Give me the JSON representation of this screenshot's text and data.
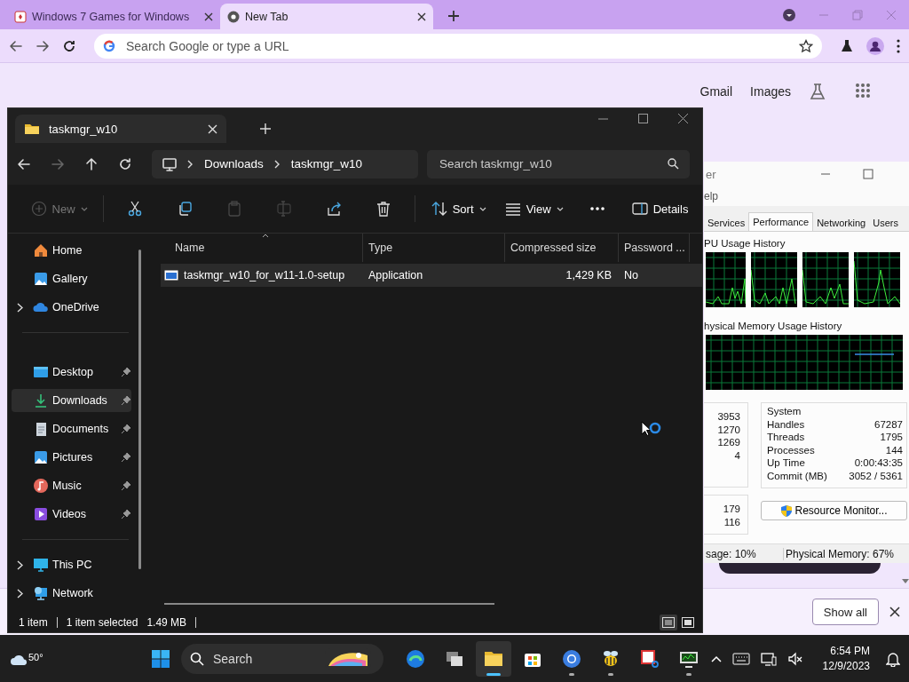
{
  "browser": {
    "tabs": [
      {
        "title": "Windows 7 Games for Windows",
        "selected": false
      },
      {
        "title": "New Tab",
        "selected": true
      }
    ],
    "omnibox": {
      "placeholder": "Search Google or type a URL"
    },
    "links": [
      "Gmail",
      "Images"
    ],
    "download_bar": {
      "button": "Show all"
    }
  },
  "task_manager": {
    "title": "er",
    "menu": [
      "elp"
    ],
    "tabs": [
      {
        "label": "Services",
        "selected": false
      },
      {
        "label": "Performance",
        "selected": true
      },
      {
        "label": "Networking",
        "selected": false
      },
      {
        "label": "Users",
        "selected": false
      }
    ],
    "cpu_heading": "PU Usage History",
    "memory_heading": "hysical Memory Usage History",
    "values_1": [
      "3953",
      "1270",
      "1269",
      "4"
    ],
    "values_2": [
      "179",
      "116"
    ],
    "system": {
      "heading": "System",
      "rows": [
        {
          "label": "Handles",
          "value": "67287"
        },
        {
          "label": "Threads",
          "value": "1795"
        },
        {
          "label": "Processes",
          "value": "144"
        },
        {
          "label": "Up Time",
          "value": "0:00:43:35"
        },
        {
          "label": "Commit (MB)",
          "value": "3052 / 5361"
        }
      ]
    },
    "resource_button": "Resource Monitor...",
    "status": [
      "sage: 10%",
      "Physical Memory: 67%"
    ]
  },
  "explorer": {
    "tabs": [
      {
        "title": "taskmgr_w10",
        "selected": true
      }
    ],
    "breadcrumb": [
      "Downloads",
      "taskmgr_w10"
    ],
    "search": {
      "placeholder": "Search taskmgr_w10"
    },
    "toolbar": [
      {
        "kind": "new",
        "label": "New",
        "disabled": true
      },
      {
        "kind": "cut",
        "disabled": false
      },
      {
        "kind": "copy",
        "disabled": false
      },
      {
        "kind": "paste",
        "disabled": true
      },
      {
        "kind": "rename",
        "disabled": true
      },
      {
        "kind": "share",
        "disabled": false
      },
      {
        "kind": "delete",
        "disabled": false
      },
      {
        "kind": "sort",
        "label": "Sort",
        "disabled": false
      },
      {
        "kind": "view",
        "label": "View",
        "disabled": false
      },
      {
        "kind": "more",
        "disabled": false
      },
      {
        "kind": "details",
        "label": "Details",
        "disabled": false
      }
    ],
    "nav_groups": [
      [
        {
          "label": "Home",
          "expandable": false,
          "pinned": false,
          "selected": false
        },
        {
          "label": "Gallery",
          "expandable": false,
          "pinned": false,
          "selected": false
        },
        {
          "label": "OneDrive",
          "expandable": true,
          "pinned": false,
          "selected": false
        }
      ],
      [
        {
          "label": "Desktop",
          "expandable": false,
          "pinned": true,
          "selected": false
        },
        {
          "label": "Downloads",
          "expandable": false,
          "pinned": true,
          "selected": true
        },
        {
          "label": "Documents",
          "expandable": false,
          "pinned": true,
          "selected": false
        },
        {
          "label": "Pictures",
          "expandable": false,
          "pinned": true,
          "selected": false
        },
        {
          "label": "Music",
          "expandable": false,
          "pinned": true,
          "selected": false
        },
        {
          "label": "Videos",
          "expandable": false,
          "pinned": true,
          "selected": false
        }
      ],
      [
        {
          "label": "This PC",
          "expandable": true,
          "pinned": false,
          "selected": false
        },
        {
          "label": "Network",
          "expandable": true,
          "pinned": false,
          "selected": false
        }
      ]
    ],
    "columns": [
      "Name",
      "Type",
      "Compressed size",
      "Password ..."
    ],
    "rows": [
      {
        "cells": [
          "taskmgr_w10_for_w11-1.0-setup",
          "Application",
          "1,429 KB",
          "No"
        ],
        "selected": true
      }
    ],
    "status": {
      "count": "1 item",
      "selection": "1 item selected",
      "size": "1.49 MB"
    },
    "views": [
      {
        "kind": "details",
        "selected": true
      },
      {
        "kind": "tiles",
        "selected": false
      }
    ]
  },
  "taskbar": {
    "weather": "50°",
    "search": {
      "placeholder": "Search"
    },
    "apps": [
      {
        "kind": "edge",
        "running": false,
        "active": false
      },
      {
        "kind": "taskview",
        "running": false,
        "active": false
      },
      {
        "kind": "explorer",
        "running": true,
        "active": true
      },
      {
        "kind": "store",
        "running": false,
        "active": false
      },
      {
        "kind": "chrome",
        "running": true,
        "active": false
      },
      {
        "kind": "bee",
        "running": true,
        "active": false
      },
      {
        "kind": "snip",
        "running": false,
        "active": false
      },
      {
        "kind": "monitor",
        "running": true,
        "active": false
      }
    ],
    "time": "6:54 PM",
    "date": "12/9/2023"
  }
}
